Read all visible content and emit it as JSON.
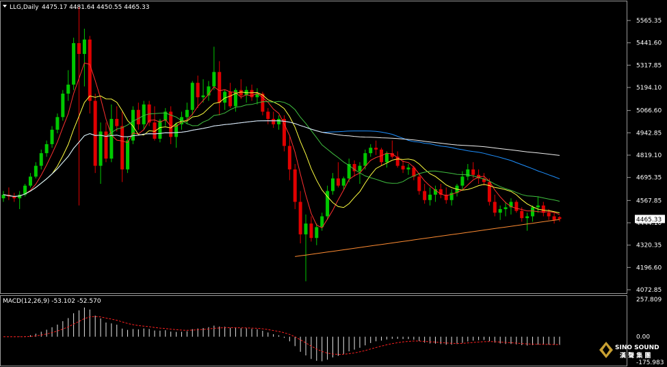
{
  "window": {
    "title": "LLG,Daily",
    "ohlc": "4475.17 4481.64 4450.55 4465.33",
    "menu_icon": "triangle-down-icon"
  },
  "price_axis": {
    "labels": [
      "5565.35",
      "5441.60",
      "5317.85",
      "5194.10",
      "5066.60",
      "4942.85",
      "4819.10",
      "4695.35",
      "4567.85",
      "4444.10",
      "4320.35",
      "4196.60",
      "4072.85"
    ],
    "current_price": "4465.33"
  },
  "macd": {
    "label": "MACD(12,26,9) -53.102 -52.570",
    "axis_labels": [
      "257.809",
      "0.00",
      "-175.983"
    ]
  },
  "watermark": {
    "brand": "SINO SOUND",
    "sub": "漢 聲 集 團",
    "icon": "diamond-logo-icon"
  },
  "colors": {
    "bull": "#00c800",
    "bear": "#e00000",
    "ma_red": "#ff3030",
    "ma_yellow": "#ffff40",
    "ma_green": "#40c040",
    "ma_blue": "#1e90ff",
    "ma_white": "#f0f0f0",
    "ma_orange": "#ff8c32",
    "macd_signal": "#ff2020"
  },
  "chart_data": {
    "type": "candlestick",
    "symbol": "LLG",
    "timeframe": "Daily",
    "ylim": [
      4072.85,
      5565.35
    ],
    "candles": [
      [
        4580,
        4620,
        4560,
        4600
      ],
      [
        4600,
        4640,
        4570,
        4590
      ],
      [
        4590,
        4610,
        4560,
        4580
      ],
      [
        4580,
        4620,
        4520,
        4600
      ],
      [
        4600,
        4660,
        4590,
        4650
      ],
      [
        4650,
        4720,
        4640,
        4700
      ],
      [
        4700,
        4780,
        4690,
        4760
      ],
      [
        4760,
        4850,
        4740,
        4830
      ],
      [
        4830,
        4900,
        4810,
        4880
      ],
      [
        4880,
        4980,
        4860,
        4960
      ],
      [
        4960,
        5050,
        4940,
        5030
      ],
      [
        5030,
        5180,
        5010,
        5160
      ],
      [
        5160,
        5290,
        5120,
        5210
      ],
      [
        5210,
        5470,
        5180,
        5440
      ],
      [
        5440,
        5640,
        4540,
        5380
      ],
      [
        5380,
        5520,
        5200,
        5460
      ],
      [
        5460,
        5480,
        5050,
        5120
      ],
      [
        5120,
        5160,
        4720,
        4760
      ],
      [
        4760,
        5000,
        4660,
        4950
      ],
      [
        4950,
        5000,
        4780,
        4800
      ],
      [
        4800,
        5100,
        4780,
        5020
      ],
      [
        5020,
        5090,
        4950,
        4980
      ],
      [
        4980,
        5060,
        4670,
        4740
      ],
      [
        4740,
        4920,
        4720,
        4900
      ],
      [
        4900,
        5090,
        4880,
        5070
      ],
      [
        5070,
        5110,
        4960,
        4990
      ],
      [
        4990,
        5120,
        4960,
        5100
      ],
      [
        5100,
        5120,
        4980,
        5000
      ],
      [
        5000,
        5090,
        4900,
        4910
      ],
      [
        4910,
        5020,
        4890,
        5010
      ],
      [
        5010,
        5080,
        4980,
        5060
      ],
      [
        5060,
        5090,
        4880,
        4920
      ],
      [
        4920,
        5000,
        4860,
        4990
      ],
      [
        4990,
        5060,
        4960,
        5030
      ],
      [
        5030,
        5110,
        4990,
        5070
      ],
      [
        5070,
        5230,
        5040,
        5220
      ],
      [
        5220,
        5260,
        5080,
        5140
      ],
      [
        5140,
        5240,
        5110,
        5150
      ],
      [
        5150,
        5230,
        5120,
        5200
      ],
      [
        5200,
        5420,
        5180,
        5280
      ],
      [
        5280,
        5340,
        5040,
        5110
      ],
      [
        5110,
        5180,
        5070,
        5170
      ],
      [
        5170,
        5220,
        5080,
        5090
      ],
      [
        5090,
        5190,
        5060,
        5180
      ],
      [
        5180,
        5240,
        5130,
        5150
      ],
      [
        5150,
        5200,
        5110,
        5180
      ],
      [
        5180,
        5210,
        5120,
        5140
      ],
      [
        5140,
        5190,
        5100,
        5160
      ],
      [
        5160,
        5170,
        5040,
        5060
      ],
      [
        5060,
        5080,
        4990,
        5020
      ],
      [
        5020,
        5060,
        4970,
        4990
      ],
      [
        4990,
        5040,
        4960,
        5020
      ],
      [
        5020,
        5040,
        4840,
        4870
      ],
      [
        4870,
        4920,
        4680,
        4740
      ],
      [
        4740,
        4770,
        4520,
        4560
      ],
      [
        4560,
        4620,
        4330,
        4380
      ],
      [
        4380,
        4490,
        4120,
        4440
      ],
      [
        4440,
        4480,
        4340,
        4360
      ],
      [
        4360,
        4440,
        4320,
        4420
      ],
      [
        4420,
        4500,
        4400,
        4480
      ],
      [
        4480,
        4650,
        4460,
        4620
      ],
      [
        4620,
        4720,
        4600,
        4690
      ],
      [
        4690,
        4780,
        4640,
        4650
      ],
      [
        4650,
        4700,
        4630,
        4690
      ],
      [
        4690,
        4800,
        4670,
        4770
      ],
      [
        4770,
        4790,
        4700,
        4730
      ],
      [
        4730,
        4780,
        4660,
        4760
      ],
      [
        4760,
        4850,
        4740,
        4830
      ],
      [
        4830,
        4880,
        4810,
        4860
      ],
      [
        4860,
        4900,
        4820,
        4850
      ],
      [
        4850,
        4860,
        4760,
        4780
      ],
      [
        4780,
        4840,
        4750,
        4830
      ],
      [
        4830,
        4900,
        4800,
        4810
      ],
      [
        4810,
        4840,
        4750,
        4760
      ],
      [
        4760,
        4790,
        4720,
        4740
      ],
      [
        4740,
        4770,
        4710,
        4750
      ],
      [
        4750,
        4760,
        4680,
        4700
      ],
      [
        4700,
        4720,
        4600,
        4620
      ],
      [
        4620,
        4660,
        4550,
        4570
      ],
      [
        4570,
        4640,
        4540,
        4600
      ],
      [
        4600,
        4650,
        4560,
        4630
      ],
      [
        4630,
        4660,
        4580,
        4600
      ],
      [
        4600,
        4640,
        4550,
        4570
      ],
      [
        4570,
        4630,
        4540,
        4610
      ],
      [
        4610,
        4660,
        4590,
        4650
      ],
      [
        4650,
        4730,
        4630,
        4700
      ],
      [
        4700,
        4770,
        4680,
        4740
      ],
      [
        4740,
        4780,
        4690,
        4710
      ],
      [
        4710,
        4740,
        4660,
        4690
      ],
      [
        4690,
        4720,
        4650,
        4670
      ],
      [
        4670,
        4690,
        4540,
        4560
      ],
      [
        4560,
        4600,
        4480,
        4500
      ],
      [
        4500,
        4540,
        4460,
        4520
      ],
      [
        4520,
        4560,
        4480,
        4530
      ],
      [
        4530,
        4580,
        4490,
        4560
      ],
      [
        4560,
        4570,
        4500,
        4510
      ],
      [
        4510,
        4530,
        4450,
        4470
      ],
      [
        4470,
        4500,
        4400,
        4480
      ],
      [
        4480,
        4540,
        4450,
        4530
      ],
      [
        4530,
        4590,
        4500,
        4540
      ],
      [
        4540,
        4560,
        4480,
        4500
      ],
      [
        4500,
        4520,
        4460,
        4480
      ],
      [
        4480,
        4500,
        4440,
        4460
      ],
      [
        4475.17,
        4481.64,
        4450.55,
        4465.33
      ]
    ],
    "macd_range": [
      -175.983,
      257.809
    ]
  }
}
